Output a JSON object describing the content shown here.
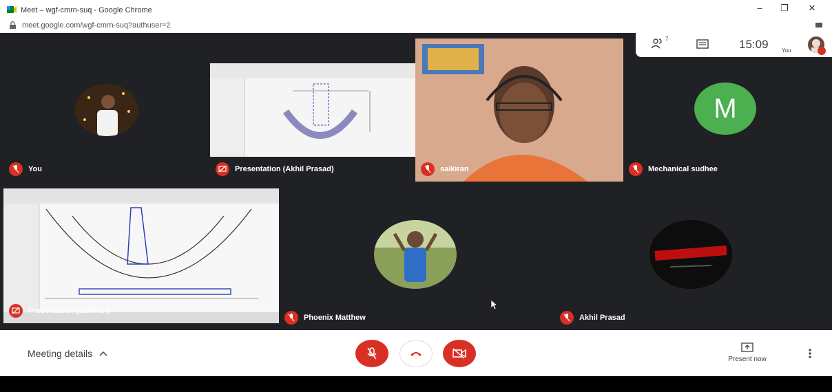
{
  "window": {
    "title": "Meet – wgf-cmrn-suq - Google Chrome",
    "url": "meet.google.com/wgf-cmrn-suq?authuser=2"
  },
  "topbar": {
    "people_count": "7",
    "clock": "15:09",
    "self_label": "You"
  },
  "tiles": [
    {
      "name": "You",
      "kind": "photo-avatar"
    },
    {
      "name": "Presentation (Akhil Prasad)",
      "kind": "presentation"
    },
    {
      "name": "saikiran",
      "kind": "video"
    },
    {
      "name": "Mechanical sudhee",
      "kind": "letter-avatar",
      "letter": "M",
      "color": "#4caf50"
    },
    {
      "name": "Presentation (saikiran)",
      "kind": "presentation"
    },
    {
      "name": "Phoenix Matthew",
      "kind": "photo-avatar"
    },
    {
      "name": "Akhil Prasad",
      "kind": "logo-avatar"
    }
  ],
  "bottombar": {
    "meeting_details": "Meeting details",
    "present_now": "Present now"
  },
  "colors": {
    "stage": "#202124",
    "mic_off": "#d93025",
    "avatar_m": "#4caf50"
  }
}
